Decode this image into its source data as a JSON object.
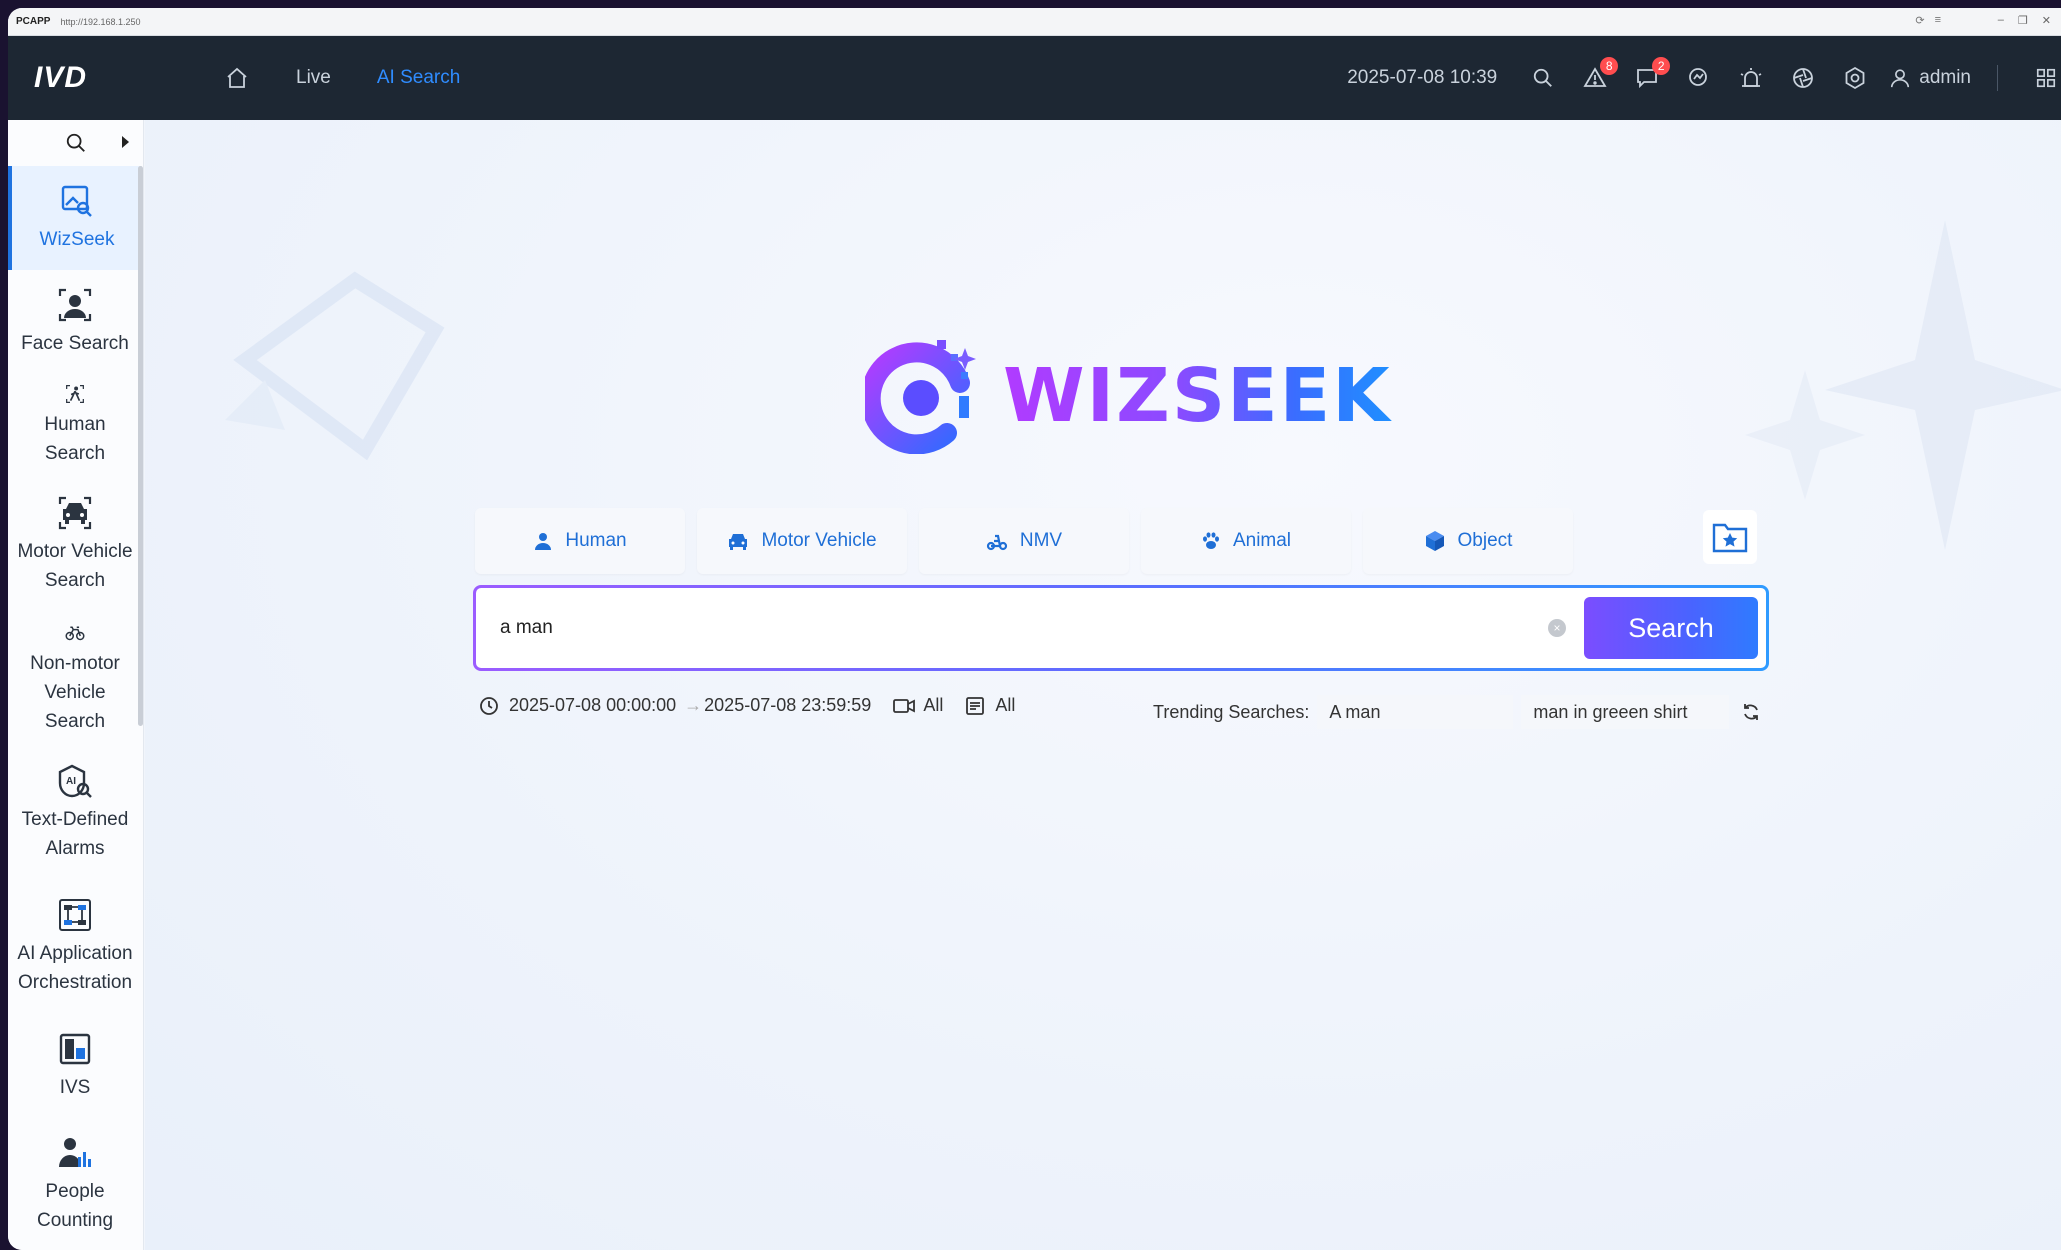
{
  "browser": {
    "app_tag": "PCAPP",
    "url": "http://192.168.1.250"
  },
  "topnav": {
    "logo": "IVD",
    "links": [
      "Live",
      "AI Search"
    ],
    "datetime": "2025-07-08 10:39",
    "alarm_count": "8",
    "message_count": "2",
    "user": "admin"
  },
  "sidebar": {
    "items": [
      {
        "label": "WizSeek",
        "icon": "image-search-icon"
      },
      {
        "label": "Face Search",
        "icon": "face-icon"
      },
      {
        "label": "Human Search",
        "icon": "walking-person-icon"
      },
      {
        "label": "Motor Vehicle Search",
        "icon": "car-icon"
      },
      {
        "label": "Non-motor Vehicle Search",
        "icon": "bicycle-icon"
      },
      {
        "label": "Text-Defined Alarms",
        "icon": "ai-search-icon"
      },
      {
        "label": "AI Application Orchestration",
        "icon": "orchestration-icon"
      },
      {
        "label": "IVS",
        "icon": "ivs-icon"
      },
      {
        "label": "People Counting",
        "icon": "people-counting-icon"
      }
    ]
  },
  "main": {
    "brand": "WIZSEEK",
    "categories": [
      "Human",
      "Motor Vehicle",
      "NMV",
      "Animal",
      "Object"
    ],
    "search": {
      "value": "a man",
      "button": "Search"
    },
    "filters": {
      "start": "2025-07-08 00:00:00",
      "end": "2025-07-08 23:59:59",
      "camera": "All",
      "record": "All"
    },
    "trending": {
      "label": "Trending Searches:",
      "items": [
        "A man",
        "man in greeen shirt"
      ]
    }
  },
  "colors": {
    "accent": "#1f73e0",
    "nav_bg": "#1d2733",
    "search_gradient_start": "#7b4dff",
    "search_gradient_end": "#2f7bff"
  }
}
